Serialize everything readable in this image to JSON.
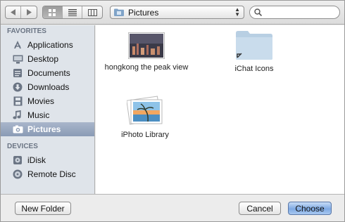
{
  "toolbar": {
    "location": "Pictures",
    "search_value": ""
  },
  "sidebar": {
    "favorites_title": "FAVORITES",
    "favorites": [
      {
        "label": "Applications",
        "icon": "applications-icon"
      },
      {
        "label": "Desktop",
        "icon": "desktop-icon"
      },
      {
        "label": "Documents",
        "icon": "documents-icon"
      },
      {
        "label": "Downloads",
        "icon": "downloads-icon"
      },
      {
        "label": "Movies",
        "icon": "movies-icon"
      },
      {
        "label": "Music",
        "icon": "music-icon"
      },
      {
        "label": "Pictures",
        "icon": "pictures-icon"
      }
    ],
    "devices_title": "DEVICES",
    "devices": [
      {
        "label": "iDisk",
        "icon": "idisk-icon"
      },
      {
        "label": "Remote Disc",
        "icon": "remote-disc-icon"
      }
    ]
  },
  "files": [
    {
      "name": "hongkong the peak view",
      "icon": "photo-thumbnail-icon"
    },
    {
      "name": "iChat Icons",
      "icon": "folder-alias-icon"
    },
    {
      "name": "iPhoto Library",
      "icon": "iphoto-library-icon"
    }
  ],
  "buttons": {
    "new_folder": "New Folder",
    "cancel": "Cancel",
    "choose": "Choose"
  },
  "colors": {
    "selection": "#8a9bb5",
    "default_button": "#7ea9e3",
    "sidebar_bg": "#dfe4ea"
  }
}
